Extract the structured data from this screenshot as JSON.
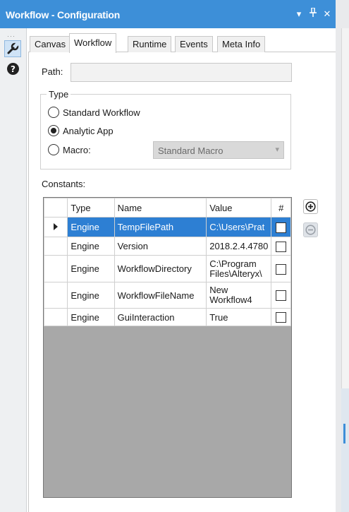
{
  "window": {
    "title": "Workflow - Configuration",
    "controls": [
      "▾",
      "⊥",
      "✕"
    ]
  },
  "toolbar": {
    "tool_icon": "wrench-icon",
    "help_icon": "help-icon",
    "help_glyph": "?"
  },
  "tabs": [
    {
      "label": "Canvas",
      "active": false
    },
    {
      "label": "Workflow",
      "active": true
    },
    {
      "label": "Runtime",
      "active": false
    },
    {
      "label": "Events",
      "active": false
    },
    {
      "label": "Meta Info",
      "active": false
    }
  ],
  "path": {
    "label": "Path:",
    "value": ""
  },
  "type_group": {
    "legend": "Type",
    "options": [
      {
        "label": "Standard Workflow",
        "checked": false
      },
      {
        "label": "Analytic App",
        "checked": true
      },
      {
        "label": "Macro:",
        "checked": false
      }
    ],
    "macro_select": "Standard Macro"
  },
  "constants": {
    "label": "Constants:",
    "columns": [
      "Type",
      "Name",
      "Value",
      "#"
    ],
    "rows": [
      {
        "type": "Engine",
        "name": "TempFilePath",
        "value": "C:\\Users\\Prat",
        "checked": false,
        "selected": true
      },
      {
        "type": "Engine",
        "name": "Version",
        "value": "2018.2.4.4780",
        "checked": false,
        "selected": false
      },
      {
        "type": "Engine",
        "name": "WorkflowDirectory",
        "value_line1": "C:\\Program",
        "value_line2": "Files\\Alteryx\\",
        "checked": false,
        "selected": false
      },
      {
        "type": "Engine",
        "name": "WorkflowFileName",
        "value_line1": "New",
        "value_line2": "Workflow4",
        "checked": false,
        "selected": false
      },
      {
        "type": "Engine",
        "name": "GuiInteraction",
        "value": "True",
        "checked": false,
        "selected": false
      }
    ],
    "add_icon": "add-circle-icon",
    "remove_icon": "remove-circle-icon"
  },
  "colors": {
    "titlebar": "#3d8fd8",
    "selection": "#2d7fd3"
  }
}
